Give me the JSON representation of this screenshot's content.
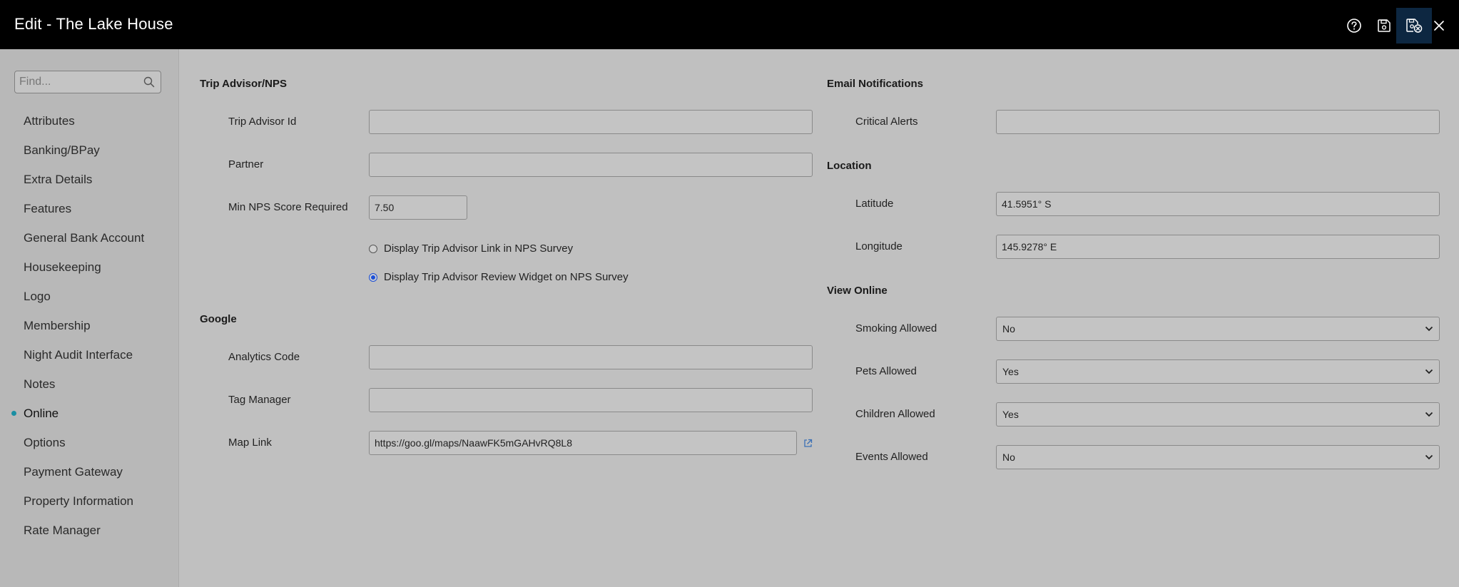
{
  "window": {
    "title": "Edit - The Lake House"
  },
  "toolbar": {
    "help_icon": "help-icon",
    "save_icon": "save-icon",
    "save_close_icon": "save-close-icon",
    "close_icon": "close-icon"
  },
  "sidebar": {
    "search_placeholder": "Find...",
    "items": [
      {
        "label": "Attributes"
      },
      {
        "label": "Banking/BPay"
      },
      {
        "label": "Extra Details"
      },
      {
        "label": "Features"
      },
      {
        "label": "General Bank Account"
      },
      {
        "label": "Housekeeping"
      },
      {
        "label": "Logo"
      },
      {
        "label": "Membership"
      },
      {
        "label": "Night Audit Interface"
      },
      {
        "label": "Notes"
      },
      {
        "label": "Online"
      },
      {
        "label": "Options"
      },
      {
        "label": "Payment Gateway"
      },
      {
        "label": "Property Information"
      },
      {
        "label": "Rate Manager"
      }
    ],
    "active_index": 10
  },
  "tripadvisor": {
    "heading": "Trip Advisor/NPS",
    "trip_advisor_id": {
      "label": "Trip Advisor Id",
      "value": ""
    },
    "partner": {
      "label": "Partner",
      "value": ""
    },
    "min_nps": {
      "label": "Min NPS Score Required",
      "value": "7.50"
    },
    "radio_link": {
      "label": "Display Trip Advisor Link in NPS Survey",
      "checked": false
    },
    "radio_widget": {
      "label": "Display Trip Advisor Review Widget on NPS Survey",
      "checked": true
    }
  },
  "google": {
    "heading": "Google",
    "analytics": {
      "label": "Analytics Code",
      "value": ""
    },
    "tag_manager": {
      "label": "Tag Manager",
      "value": ""
    },
    "map_link": {
      "label": "Map Link",
      "value": "https://goo.gl/maps/NaawFK5mGAHvRQ8L8"
    }
  },
  "email": {
    "heading": "Email Notifications",
    "critical_alerts": {
      "label": "Critical Alerts",
      "value": ""
    }
  },
  "location": {
    "heading": "Location",
    "latitude": {
      "label": "Latitude",
      "value": "41.5951° S"
    },
    "longitude": {
      "label": "Longitude",
      "value": "145.9278° E"
    }
  },
  "view_online": {
    "heading": "View Online",
    "smoking": {
      "label": "Smoking Allowed",
      "value": "No"
    },
    "pets": {
      "label": "Pets Allowed",
      "value": "Yes"
    },
    "children": {
      "label": "Children Allowed",
      "value": "Yes"
    },
    "events": {
      "label": "Events Allowed",
      "value": "No"
    }
  },
  "colors": {
    "topbar": "#000000",
    "content_bg": "#c0c0c0",
    "sidebar_bg": "#b8b8b8",
    "active_dot": "#1a8fa3",
    "radio_checked": "#1b4fd8",
    "active_toolbar_button": "#0d2741"
  }
}
